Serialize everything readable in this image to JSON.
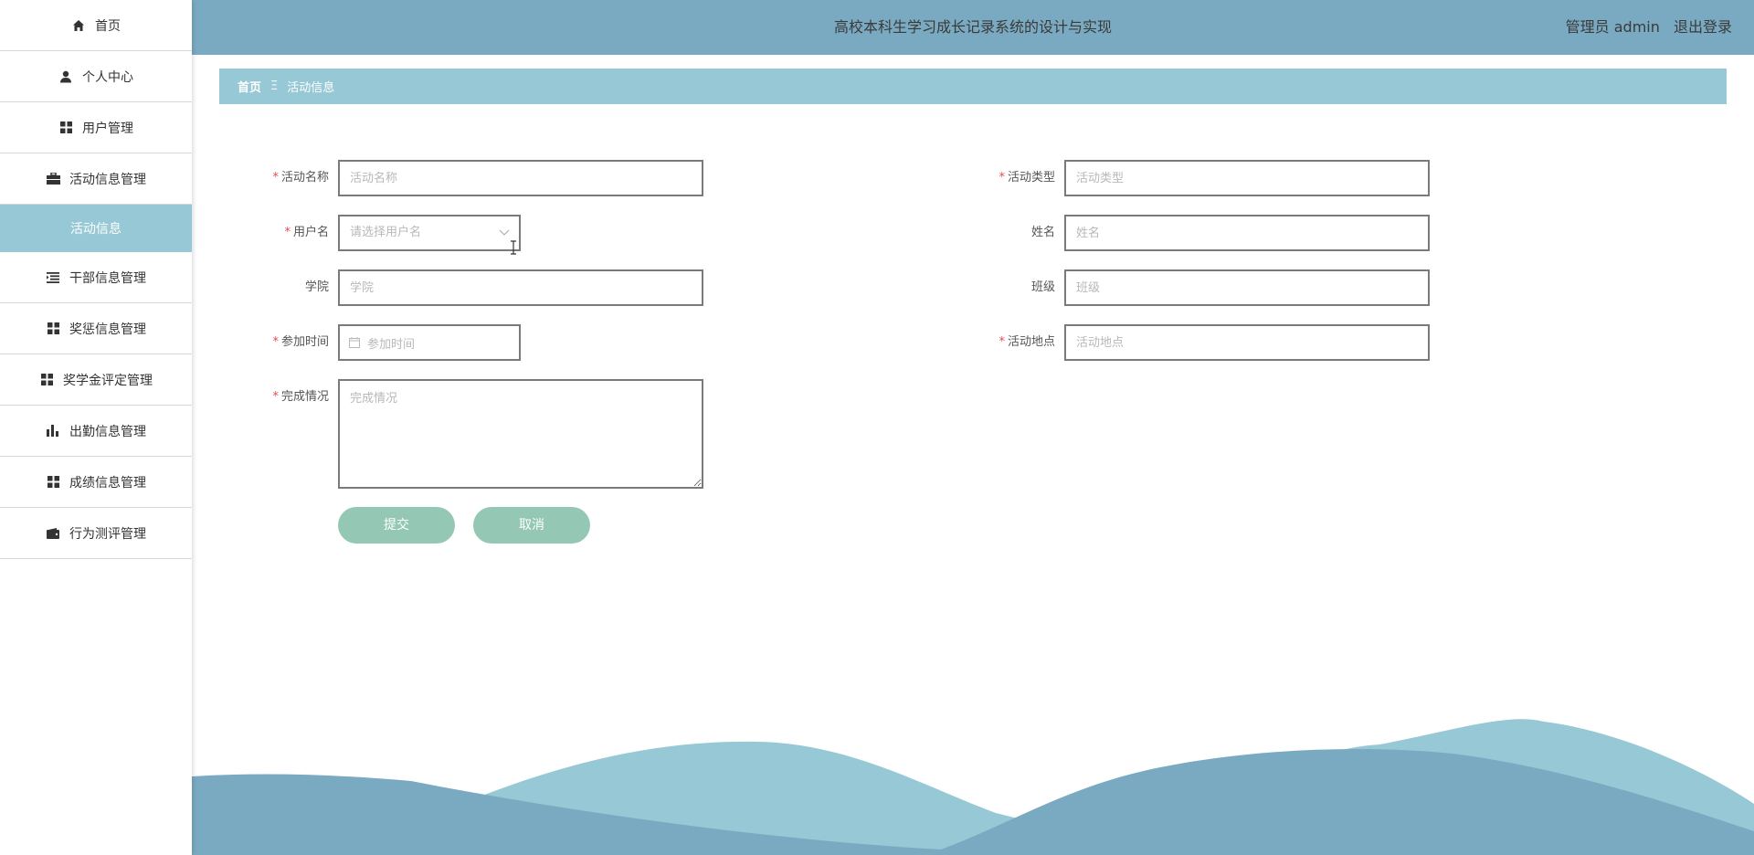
{
  "sidebar": {
    "items": [
      {
        "label": "首页",
        "icon": "home-icon"
      },
      {
        "label": "个人中心",
        "icon": "user-icon"
      },
      {
        "label": "用户管理",
        "icon": "grid-icon"
      },
      {
        "label": "活动信息管理",
        "icon": "briefcase-icon"
      },
      {
        "label": "活动信息",
        "icon": "",
        "active": true
      },
      {
        "label": "干部信息管理",
        "icon": "list-indent-icon"
      },
      {
        "label": "奖惩信息管理",
        "icon": "grid-icon"
      },
      {
        "label": "奖学金评定管理",
        "icon": "grid-icon"
      },
      {
        "label": "出勤信息管理",
        "icon": "bar-chart-icon"
      },
      {
        "label": "成绩信息管理",
        "icon": "grid-icon"
      },
      {
        "label": "行为测评管理",
        "icon": "wallet-icon"
      }
    ]
  },
  "header": {
    "title": "高校本科生学习成长记录系统的设计与实现",
    "user": "管理员 admin",
    "logout": "退出登录"
  },
  "breadcrumb": {
    "home": "首页",
    "separator": "Ξ",
    "current": "活动信息"
  },
  "form": {
    "activity_name": {
      "label": "活动名称",
      "placeholder": "活动名称",
      "required": true
    },
    "activity_type": {
      "label": "活动类型",
      "placeholder": "活动类型",
      "required": true
    },
    "username": {
      "label": "用户名",
      "placeholder": "请选择用户名",
      "required": true
    },
    "name": {
      "label": "姓名",
      "placeholder": "姓名",
      "required": false
    },
    "college": {
      "label": "学院",
      "placeholder": "学院",
      "required": false
    },
    "class": {
      "label": "班级",
      "placeholder": "班级",
      "required": false
    },
    "join_time": {
      "label": "参加时间",
      "placeholder": "参加时间",
      "required": true
    },
    "location": {
      "label": "活动地点",
      "placeholder": "活动地点",
      "required": true
    },
    "completion": {
      "label": "完成情况",
      "placeholder": "完成情况",
      "required": true
    },
    "required_mark": "*",
    "submit": "提交",
    "cancel": "取消"
  },
  "colors": {
    "header_bg": "#7aaac1",
    "accent_light": "#97c8d5",
    "button": "#94c8b4",
    "required": "#e64c4c"
  }
}
